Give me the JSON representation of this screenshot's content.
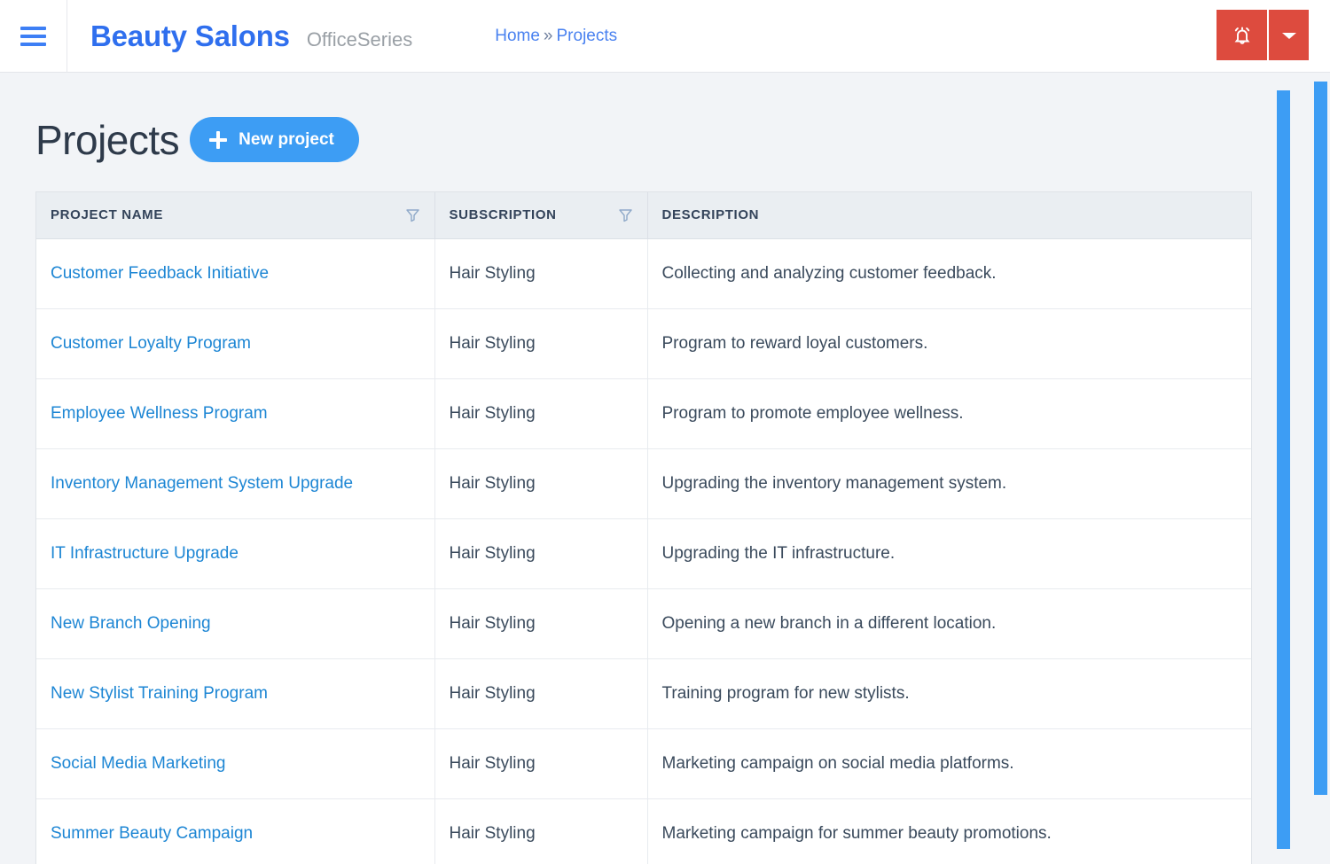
{
  "header": {
    "menu_icon": "hamburger-icon",
    "brand_title": "Beauty Salons",
    "brand_subtitle": "OfficeSeries",
    "breadcrumb": {
      "home": "Home",
      "separator": "»",
      "current": "Projects"
    },
    "actions": {
      "notifications_icon": "bell-icon",
      "dropdown_icon": "caret-down-icon"
    },
    "colors": {
      "brand_blue": "#2f6fee",
      "link_blue": "#4a82f0",
      "action_red": "#dd4b3e"
    }
  },
  "main": {
    "page_title": "Projects",
    "new_project_button": {
      "label": "New project",
      "icon": "plus-icon",
      "color": "#3d9df4"
    },
    "table": {
      "columns": [
        {
          "label": "PROJECT NAME",
          "filterable": true,
          "filter_icon": "funnel-icon"
        },
        {
          "label": "SUBSCRIPTION",
          "filterable": true,
          "filter_icon": "funnel-icon"
        },
        {
          "label": "DESCRIPTION",
          "filterable": false,
          "filter_icon": ""
        }
      ],
      "rows": [
        {
          "name": "Customer Feedback Initiative",
          "subscription": "Hair Styling",
          "description": "Collecting and analyzing customer feedback."
        },
        {
          "name": "Customer Loyalty Program",
          "subscription": "Hair Styling",
          "description": "Program to reward loyal customers."
        },
        {
          "name": "Employee Wellness Program",
          "subscription": "Hair Styling",
          "description": "Program to promote employee wellness."
        },
        {
          "name": "Inventory Management System Upgrade",
          "subscription": "Hair Styling",
          "description": "Upgrading the inventory management system."
        },
        {
          "name": "IT Infrastructure Upgrade",
          "subscription": "Hair Styling",
          "description": "Upgrading the IT infrastructure."
        },
        {
          "name": "New Branch Opening",
          "subscription": "Hair Styling",
          "description": "Opening a new branch in a different location."
        },
        {
          "name": "New Stylist Training Program",
          "subscription": "Hair Styling",
          "description": "Training program for new stylists."
        },
        {
          "name": "Social Media Marketing",
          "subscription": "Hair Styling",
          "description": "Marketing campaign on social media platforms."
        },
        {
          "name": "Summer Beauty Campaign",
          "subscription": "Hair Styling",
          "description": "Marketing campaign for summer beauty promotions."
        }
      ]
    }
  },
  "scrollbars": {
    "inner_color": "#3d9df4",
    "outer_color": "#3d9df4"
  }
}
